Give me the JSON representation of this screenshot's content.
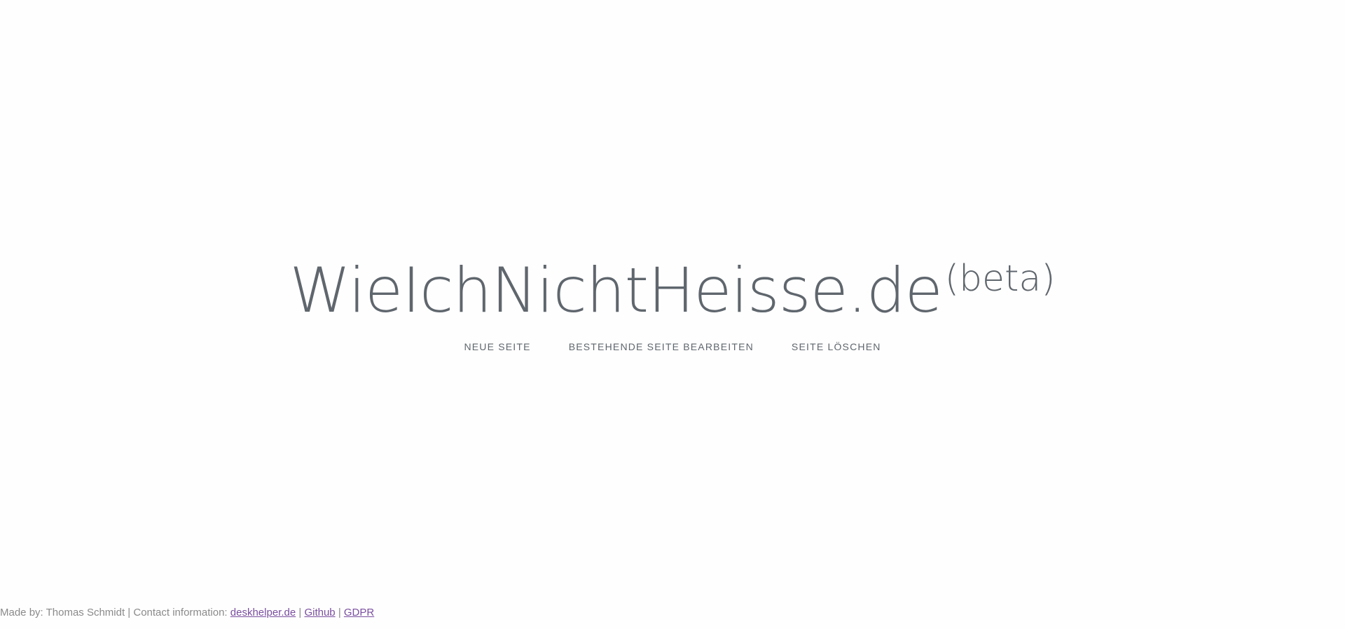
{
  "hero": {
    "title": "WieIchNichtHeisse.de",
    "badge": "(beta)"
  },
  "nav": {
    "items": [
      {
        "label": "NEUE SEITE"
      },
      {
        "label": "BESTEHENDE SEITE BEARBEITEN"
      },
      {
        "label": "SEITE LÖSCHEN"
      }
    ]
  },
  "footer": {
    "prefix": "Made by: Thomas Schmidt | Contact information:",
    "links": [
      {
        "label": "deskhelper.de"
      },
      {
        "label": "Github"
      },
      {
        "label": "GDPR"
      }
    ],
    "separator": "|"
  },
  "colors": {
    "text": "#5f666d",
    "footer_text": "#8a8a8a",
    "link": "#7a4fa0",
    "background": "#fefefe"
  }
}
